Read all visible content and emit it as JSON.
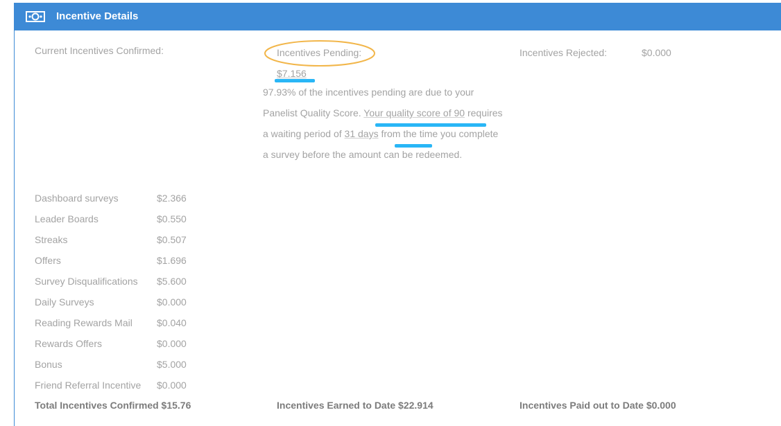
{
  "header": {
    "title": "Incentive Details",
    "icon": "money-icon"
  },
  "confirmed": {
    "label": "Current Incentives Confirmed:",
    "items": [
      {
        "label": "Dashboard surveys",
        "value": "$2.366"
      },
      {
        "label": "Leader Boards",
        "value": "$0.550"
      },
      {
        "label": "Streaks",
        "value": "$0.507"
      },
      {
        "label": "Offers",
        "value": "$1.696"
      },
      {
        "label": "Survey Disqualifications",
        "value": "$5.600"
      },
      {
        "label": "Daily Surveys",
        "value": "$0.000"
      },
      {
        "label": "Reading Rewards Mail",
        "value": "$0.040"
      },
      {
        "label": "Rewards Offers",
        "value": "$0.000"
      },
      {
        "label": "Bonus",
        "value": "$5.000"
      },
      {
        "label": "Friend Referral Incentive",
        "value": "$0.000"
      }
    ],
    "total": "Total Incentives Confirmed $15.76"
  },
  "pending": {
    "label": "Incentives Pending:",
    "value": "$7.156",
    "text1": "97.93% of the incentives pending are due to your Panelist Quality Score.",
    "link_quality": "Your quality score of 90",
    "text2": "requires a waiting period of",
    "link_days": "31 days",
    "text3": "from the time you complete a survey before the amount can be redeemed.",
    "earned": "Incentives Earned to Date $22.914"
  },
  "rejected": {
    "label": "Incentives Rejected:",
    "value": "$0.000",
    "paid": "Incentives Paid out to Date $0.000"
  },
  "colors": {
    "header": "#3d8ad6",
    "highlight": "#29b6f6",
    "circle": "#f2b64a"
  }
}
